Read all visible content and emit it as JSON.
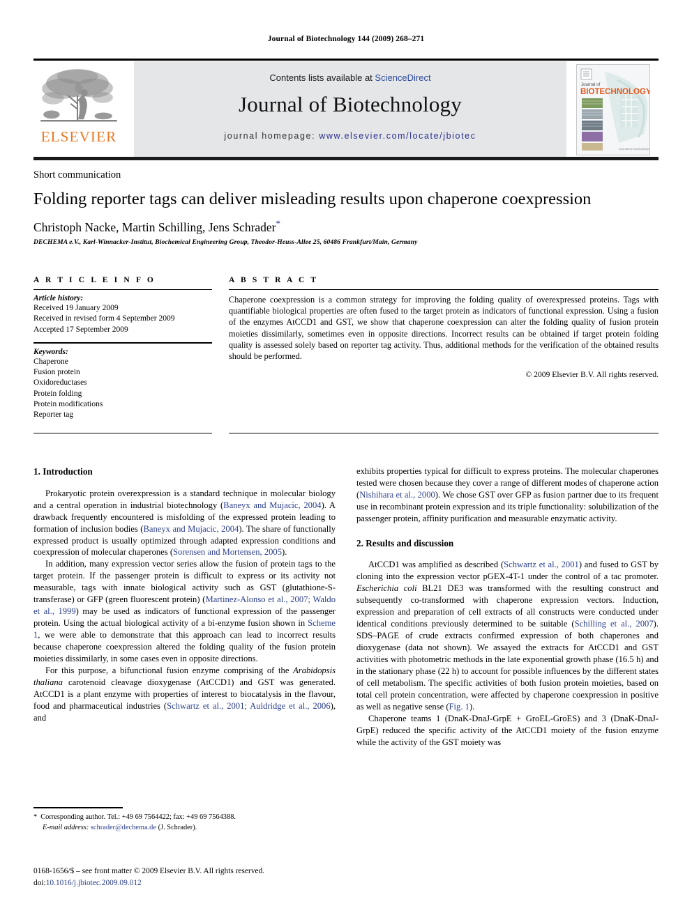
{
  "running_head": "Journal of Biotechnology 144 (2009) 268–271",
  "masthead": {
    "contents_prefix": "Contents lists available at ",
    "sciencedirect": "ScienceDirect",
    "journal_title": "Journal of Biotechnology",
    "homepage_prefix": "journal homepage: ",
    "homepage_url": "www.elsevier.com/locate/jbiotec",
    "publisher_wordmark": "ELSEVIER",
    "publisher_color": "#ee7722",
    "link_color": "#2b2f8f",
    "band_color": "#e5e6e8",
    "cover": {
      "small_label": "Journal of",
      "big_label": "BIOTECHNOLOGY",
      "label_color": "#e2571e"
    }
  },
  "article": {
    "type": "Short communication",
    "title": "Folding reporter tags can deliver misleading results upon chaperone coexpression",
    "authors": "Christoph Nacke, Martin Schilling, Jens Schrader",
    "corresponding_marker": "*",
    "affiliation": "DECHEMA e.V., Karl-Winnacker-Institut, Biochemical Engineering Group, Theodor-Heuss-Allee 25, 60486 Frankfurt/Main, Germany"
  },
  "article_info": {
    "label": "A R T I C L E   I N F O",
    "history_head": "Article history:",
    "history": [
      "Received 19 January 2009",
      "Received in revised form 4 September 2009",
      "Accepted 17 September 2009"
    ],
    "keywords_head": "Keywords:",
    "keywords": [
      "Chaperone",
      "Fusion protein",
      "Oxidoreductases",
      "Protein folding",
      "Protein modifications",
      "Reporter tag"
    ]
  },
  "abstract": {
    "label": "A B S T R A C T",
    "text": "Chaperone coexpression is a common strategy for improving the folding quality of overexpressed proteins. Tags with quantifiable biological properties are often fused to the target protein as indicators of functional expression. Using a fusion of the enzymes AtCCD1 and GST, we show that chaperone coexpression can alter the folding quality of fusion protein moieties dissimilarly, sometimes even in opposite directions. Incorrect results can be obtained if target protein folding quality is assessed solely based on reporter tag activity. Thus, additional methods for the verification of the obtained results should be performed.",
    "copyright": "© 2009 Elsevier B.V. All rights reserved."
  },
  "sections": {
    "intro_title": "1. Introduction",
    "results_title": "2. Results and discussion"
  },
  "body": {
    "p1_a": "Prokaryotic protein overexpression is a standard technique in molecular biology and a central operation in industrial biotechnology (",
    "p1_ref1": "Baneyx and Mujacic, 2004",
    "p1_b": "). A drawback frequently encountered is misfolding of the expressed protein leading to formation of inclusion bodies (",
    "p1_ref2": "Baneyx and Mujacic, 2004",
    "p1_c": "). The share of functionally expressed product is usually optimized through adapted expression conditions and coexpression of molecular chaperones (",
    "p1_ref3": "Sorensen and Mortensen, 2005",
    "p1_d": ").",
    "p2_a": "In addition, many expression vector series allow the fusion of protein tags to the target protein. If the passenger protein is difficult to express or its activity not measurable, tags with innate biological activity such as GST (glutathione-S-transferase) or GFP (green fluorescent protein) (",
    "p2_ref1": "Martinez-Alonso et al., 2007; Waldo et al., 1999",
    "p2_b": ") may be used as indicators of functional expression of the passenger protein. Using the actual biological activity of a bi-enzyme fusion shown in ",
    "p2_ref2": "Scheme 1",
    "p2_c": ", we were able to demonstrate that this approach can lead to incorrect results because chaperone coexpression altered the folding quality of the fusion protein moieties dissimilarly, in some cases even in opposite directions.",
    "p3_a": "For this purpose, a bifunctional fusion enzyme comprising of the ",
    "p3_italic": "Arabidopsis thaliana",
    "p3_b": " carotenoid cleavage dioxygenase (AtCCD1) and GST was generated. AtCCD1 is a plant enzyme with properties of interest to biocatalysis in the flavour, food and pharmaceutical industries (",
    "p3_ref1": "Schwartz et al., 2001; Auldridge et al., 2006",
    "p3_c": "), and",
    "p4_a": "exhibits properties typical for difficult to express proteins. The molecular chaperones tested were chosen because they cover a range of different modes of chaperone action (",
    "p4_ref1": "Nishihara et al., 2000",
    "p4_b": "). We chose GST over GFP as fusion partner due to its frequent use in recombinant protein expression and its triple functionality: solubilization of the passenger protein, affinity purification and measurable enzymatic activity.",
    "p5_a": "AtCCD1 was amplified as described (",
    "p5_ref1": "Schwartz et al., 2001",
    "p5_b": ") and fused to GST by cloning into the expression vector pGEX-4T-1 under the control of a tac promoter. ",
    "p5_italic": "Escherichia coli",
    "p5_c": " BL21 DE3 was transformed with the resulting construct and subsequently co-transformed with chaperone expression vectors. Induction, expression and preparation of cell extracts of all constructs were conducted under identical conditions previously determined to be suitable (",
    "p5_ref2": "Schilling et al., 2007",
    "p5_d": "). SDS–PAGE of crude extracts confirmed expression of both chaperones and dioxygenase (data not shown). We assayed the extracts for AtCCD1 and GST activities with photometric methods in the late exponential growth phase (16.5 h) and in the stationary phase (22 h) to account for possible influences by the different states of cell metabolism. The specific activities of both fusion protein moieties, based on total cell protein concentration, were affected by chaperone coexpression in positive as well as negative sense (",
    "p5_ref3": "Fig. 1",
    "p5_e": ").",
    "p6_a": "Chaperone teams 1 (DnaK-DnaJ-GrpE + GroEL-GroES) and 3 (DnaK-DnaJ-GrpE) reduced the specific activity of the AtCCD1 moiety of the fusion enzyme while the activity of the GST moiety was"
  },
  "footnote": {
    "marker": "*",
    "corresponding": "Corresponding author. Tel.: +49 69 7564422; fax: +49 69 7564388.",
    "email_label": "E-mail address:",
    "email": "schrader@dechema.de",
    "email_suffix": "(J. Schrader)."
  },
  "footer": {
    "issn_line": "0168-1656/$ – see front matter © 2009 Elsevier B.V. All rights reserved.",
    "doi_label": "doi:",
    "doi_value": "10.1016/j.jbiotec.2009.09.012"
  }
}
